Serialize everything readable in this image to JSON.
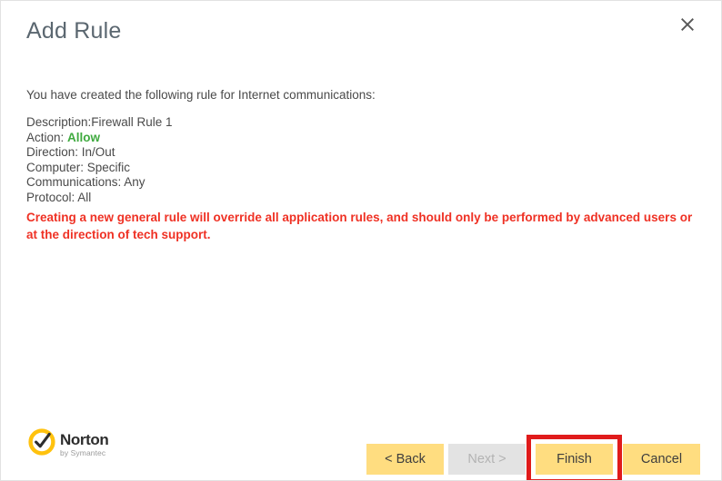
{
  "window": {
    "title": "Add Rule",
    "close_icon": "close-icon"
  },
  "content": {
    "intro": "You have created the following rule for Internet communications:",
    "summary": [
      {
        "label": "Description:",
        "value": "Firewall Rule 1",
        "emphasis": "none",
        "separator": ""
      },
      {
        "label": "Action:",
        "value": "Allow",
        "emphasis": "allow",
        "separator": " "
      },
      {
        "label": "Direction:",
        "value": "In/Out",
        "emphasis": "none",
        "separator": " "
      },
      {
        "label": "Computer:",
        "value": "Specific",
        "emphasis": "none",
        "separator": " "
      },
      {
        "label": "Communications:",
        "value": "Any",
        "emphasis": "none",
        "separator": " "
      },
      {
        "label": "Protocol:",
        "value": "All",
        "emphasis": "none",
        "separator": " "
      }
    ],
    "summary_lines": {
      "description": "Description:Firewall Rule 1",
      "action_label": "Action: ",
      "action_value": "Allow",
      "direction": "Direction: In/Out",
      "computer": "Computer: Specific",
      "communications": "Communications: Any",
      "protocol": "Protocol: All"
    },
    "warning": "Creating a new general rule will override all application rules, and should only be performed by advanced users or at the direction of tech support."
  },
  "brand": {
    "name": "Norton",
    "tagline": "by Symantec",
    "mark_icon": "norton-checkmark-icon"
  },
  "footer": {
    "buttons": {
      "back": "< Back",
      "next": "Next >",
      "finish": "Finish",
      "cancel": "Cancel"
    }
  },
  "colors": {
    "button_yellow": "#ffdd80",
    "button_disabled": "#e3e3e3",
    "warning_red": "#ef3124",
    "highlight_red": "#e01b1b",
    "allow_green": "#3faa3f",
    "title_gray": "#5b6770",
    "brand_yellow": "#ffc20e"
  }
}
